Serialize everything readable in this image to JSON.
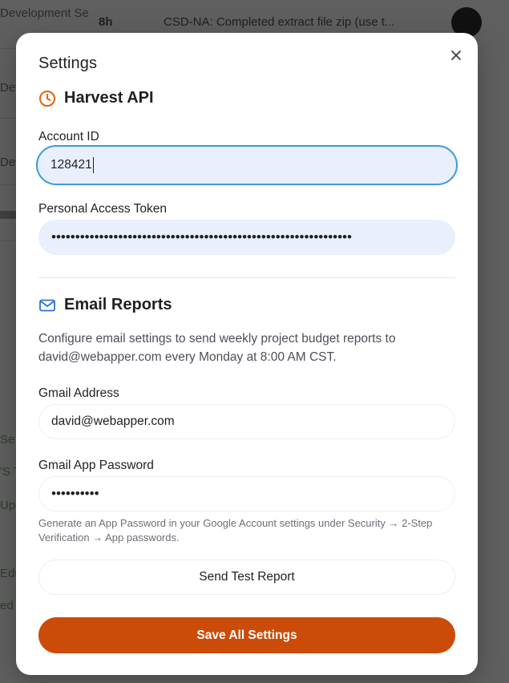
{
  "background": {
    "rows": [
      {
        "category": "Development Services",
        "hours": "8h",
        "description": "CSD-NA: Completed extract file zip (use t..."
      },
      {
        "category": "Development Services",
        "hours": "",
        "description": ""
      },
      {
        "category": "Development Services",
        "hours": "",
        "description": ""
      }
    ],
    "side_fragments": [
      "Se",
      "'S T",
      "Up",
      "Edu",
      "ed"
    ]
  },
  "modal": {
    "title": "Settings",
    "close_icon": "close-icon",
    "harvest": {
      "heading": "Harvest API",
      "icon": "clock-icon",
      "icon_color": "#e2620b",
      "account_id_label": "Account ID",
      "account_id_value": "128421",
      "token_label": "Personal Access Token",
      "token_value": "•••••••••••••••••••••••••••••••••••••••••••••••••••••••••••••••"
    },
    "email": {
      "heading": "Email Reports",
      "icon": "mail-icon",
      "icon_color": "#2f6fd6",
      "description": "Configure email settings to send weekly project budget reports to david@webapper.com every Monday at 8:00 AM CST.",
      "gmail_label": "Gmail Address",
      "gmail_value": "david@webapper.com",
      "password_label": "Gmail App Password",
      "password_value": "••••••••••",
      "help_text": "Generate an App Password in your Google Account settings under Security → 2-Step Verification → App passwords.",
      "test_button": "Send Test Report"
    },
    "save_button": "Save All Settings",
    "accent_color": "#cb4b08"
  }
}
